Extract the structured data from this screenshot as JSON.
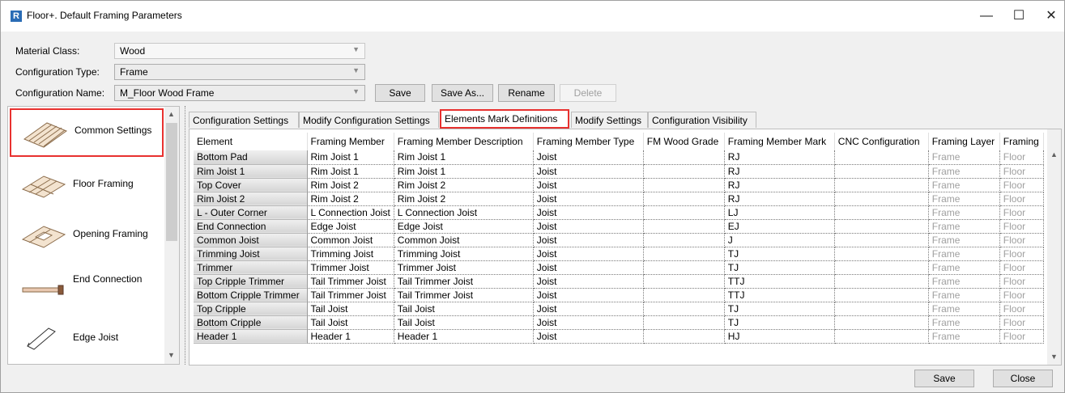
{
  "window": {
    "title": "Floor+. Default Framing Parameters",
    "app_icon_letter": "R"
  },
  "window_controls": {
    "minimize": "—",
    "maximize": "☐",
    "close": "✕"
  },
  "form": {
    "material_class_label": "Material Class:",
    "material_class_value": "Wood",
    "configuration_type_label": "Configuration Type:",
    "configuration_type_value": "Frame",
    "configuration_name_label": "Configuration Name:",
    "configuration_name_value": "M_Floor Wood Frame"
  },
  "toolbar": {
    "save": "Save",
    "save_as": "Save As...",
    "rename": "Rename",
    "delete": "Delete"
  },
  "sidebar": {
    "items": [
      {
        "label": "Common Settings",
        "icon": "common-settings-icon",
        "selected": true
      },
      {
        "label": "Floor Framing",
        "icon": "floor-framing-icon"
      },
      {
        "label": "Opening Framing",
        "icon": "opening-framing-icon"
      },
      {
        "label": "End Connection",
        "icon": "end-connection-icon"
      },
      {
        "label": "Edge Joist",
        "icon": "edge-joist-icon"
      }
    ]
  },
  "tabs": [
    {
      "label": "Configuration Settings"
    },
    {
      "label": "Modify Configuration Settings"
    },
    {
      "label": "Elements Mark Definitions",
      "active": true
    },
    {
      "label": "Modify Settings"
    },
    {
      "label": "Configuration Visibility"
    }
  ],
  "grid": {
    "columns": [
      "Element",
      "Framing Member",
      "Framing Member Description",
      "Framing Member Type",
      "FM Wood Grade",
      "Framing Member Mark",
      "CNC Configuration",
      "Framing Layer",
      "Framing"
    ],
    "rows": [
      [
        "Bottom Pad",
        "Rim Joist 1",
        "Rim Joist 1",
        "Joist",
        "",
        "RJ",
        "",
        "Frame",
        "Floor"
      ],
      [
        "Rim Joist 1",
        "Rim Joist 1",
        "Rim Joist 1",
        "Joist",
        "",
        "RJ",
        "",
        "Frame",
        "Floor"
      ],
      [
        "Top Cover",
        "Rim Joist 2",
        "Rim Joist 2",
        "Joist",
        "",
        "RJ",
        "",
        "Frame",
        "Floor"
      ],
      [
        "Rim Joist 2",
        "Rim Joist 2",
        "Rim Joist 2",
        "Joist",
        "",
        "RJ",
        "",
        "Frame",
        "Floor"
      ],
      [
        "L - Outer Corner",
        "L Connection Joist",
        "L Connection Joist",
        "Joist",
        "",
        "LJ",
        "",
        "Frame",
        "Floor"
      ],
      [
        "End Connection",
        "Edge Joist",
        "Edge Joist",
        "Joist",
        "",
        "EJ",
        "",
        "Frame",
        "Floor"
      ],
      [
        "Common Joist",
        "Common Joist",
        "Common Joist",
        "Joist",
        "",
        "J",
        "",
        "Frame",
        "Floor"
      ],
      [
        "Trimming Joist",
        "Trimming Joist",
        "Trimming Joist",
        "Joist",
        "",
        "TJ",
        "",
        "Frame",
        "Floor"
      ],
      [
        "Trimmer",
        "Trimmer Joist",
        "Trimmer Joist",
        "Joist",
        "",
        "TJ",
        "",
        "Frame",
        "Floor"
      ],
      [
        "Top Cripple Trimmer",
        "Tail Trimmer Joist",
        "Tail Trimmer Joist",
        "Joist",
        "",
        "TTJ",
        "",
        "Frame",
        "Floor"
      ],
      [
        "Bottom Cripple Trimmer",
        "Tail Trimmer Joist",
        "Tail Trimmer Joist",
        "Joist",
        "",
        "TTJ",
        "",
        "Frame",
        "Floor"
      ],
      [
        "Top Cripple",
        "Tail Joist",
        "Tail Joist",
        "Joist",
        "",
        "TJ",
        "",
        "Frame",
        "Floor"
      ],
      [
        "Bottom Cripple",
        "Tail Joist",
        "Tail Joist",
        "Joist",
        "",
        "TJ",
        "",
        "Frame",
        "Floor"
      ],
      [
        "Header 1",
        "Header 1",
        "Header 1",
        "Joist",
        "",
        "HJ",
        "",
        "Frame",
        "Floor"
      ]
    ]
  },
  "footer": {
    "save": "Save",
    "close": "Close"
  },
  "colors": {
    "highlight": "#e8312f",
    "brand": "#2a6cb5"
  }
}
